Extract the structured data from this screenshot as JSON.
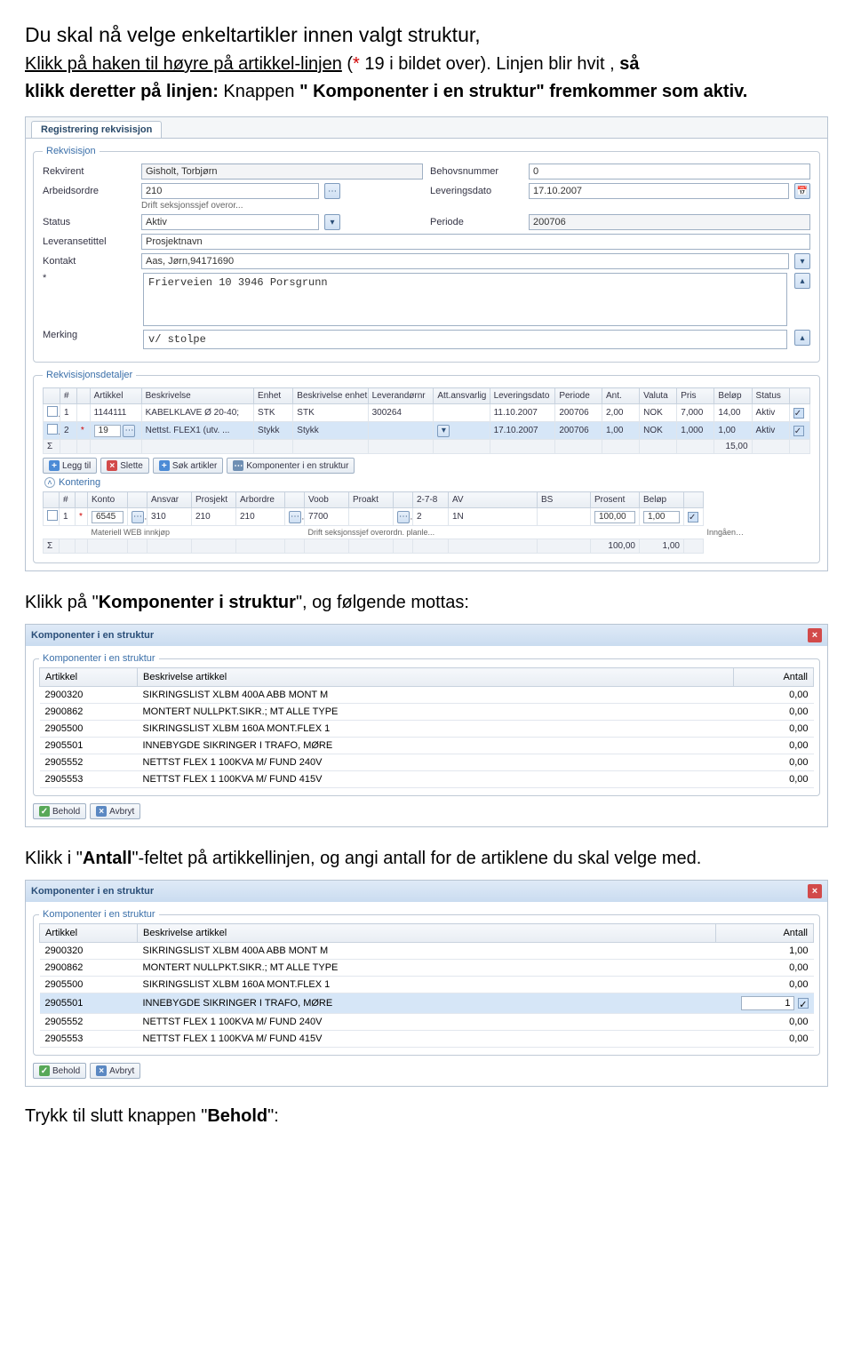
{
  "intro": {
    "line1": "Du skal nå velge enkeltartikler innen valgt struktur,",
    "line2_pre": "Klikk på haken til høyre på artikkel-linjen",
    "line2_paren_open": " (",
    "line2_star": "*",
    "line2_rest": " 19 i bildet over). Linjen blir hvit ,",
    "line2_end_bold": " så",
    "line3_bold1": "klikk deretter på linjen:",
    "line3_plain": "    Knappen ",
    "line3_bold2": "\" Komponenter i en struktur\" fremkommer som aktiv."
  },
  "app": {
    "tab": "Registrering rekvisisjon",
    "rekvisisjon_legend": "Rekvisisjon",
    "labels": {
      "rekvirent": "Rekvirent",
      "arbeidsordre": "Arbeidsordre",
      "status": "Status",
      "leveransetittel": "Leveransetittel",
      "kontakt": "Kontakt",
      "star": "*",
      "merking": "Merking",
      "behovsnummer": "Behovsnummer",
      "leveringsdato": "Leveringsdato",
      "periode": "Periode"
    },
    "values": {
      "rekvirent": "Gisholt, Torbjørn",
      "arbeidsordre": "210",
      "arbeidsordre_sub": "Drift seksjonssjef overor...",
      "status": "Aktiv",
      "leveransetittel": "Prosjektnavn",
      "kontakt": "Aas, Jørn,94171690",
      "adresse": "Frierveien 10 3946 Porsgrunn",
      "merking": "v/ stolpe",
      "behovsnummer": "0",
      "leveringsdato": "17.10.2007",
      "periode": "200706"
    },
    "detaljer_legend": "Rekvisisjonsdetaljer",
    "det_cols": [
      "",
      "#",
      "",
      "Artikkel",
      "Beskrivelse",
      "Enhet",
      "Beskrivelse enhet",
      "Leverandørnr",
      "Att.ansvarlig",
      "Leveringsdato",
      "Periode",
      "Ant.",
      "Valuta",
      "Pris",
      "Beløp",
      "Status",
      ""
    ],
    "det_rows": [
      {
        "n": "1",
        "star": "",
        "art": "1144111",
        "besk": "KABELKLAVE Ø 20-40;",
        "enh": "STK",
        "benh": "STK",
        "lev": "300264",
        "att": "",
        "dato": "11.10.2007",
        "per": "200706",
        "ant": "2,00",
        "val": "NOK",
        "pris": "7,000",
        "bel": "14,00",
        "stat": "Aktiv",
        "sel": false
      },
      {
        "n": "2",
        "star": "*",
        "art": "19",
        "besk": "Nettst. FLEX1 (utv. ...",
        "enh": "Stykk",
        "benh": "Stykk",
        "lev": "",
        "att": "",
        "dato": "17.10.2007",
        "per": "200706",
        "ant": "1,00",
        "val": "NOK",
        "pris": "1,000",
        "bel": "1,00",
        "stat": "Aktiv",
        "sel": true
      }
    ],
    "det_sum_label": "Σ",
    "det_sum": "15,00",
    "det_toolbar": {
      "legg_til": "Legg til",
      "slette": "Slette",
      "sok": "Søk artikler",
      "komp": "Komponenter i en struktur"
    },
    "kont_label": "Kontering",
    "kont_cols": [
      "",
      "#",
      "",
      "Konto",
      "",
      "Ansvar",
      "Prosjekt",
      "Arbordre",
      "",
      "Voob",
      "Proakt",
      "",
      "2-7-8",
      "AV",
      "BS",
      "Prosent",
      "Beløp",
      ""
    ],
    "kont_row": {
      "n": "1",
      "star": "*",
      "konto": "6545",
      "ansvar": "310",
      "prosjekt": "210",
      "arbordre": "210",
      "voob": "7700",
      "proakt": "",
      "t278": "2",
      "av": "1N",
      "bs": "",
      "prosent": "100,00",
      "belop": "1,00",
      "sub_left": "Materiell WEB innkjøp",
      "sub_mid": "Drift seksjonssjef overordn. planle...",
      "sub_right": "Inngående mva std høy sats (netto)"
    },
    "kont_sum_prosent": "100,00",
    "kont_sum_belop": "1,00"
  },
  "mid1_pre": "Klikk på \"",
  "mid1_bold": "Komponenter i struktur",
  "mid1_post": "\", og følgende mottas:",
  "popup": {
    "title": "Komponenter i en struktur",
    "legend": "Komponenter i en struktur",
    "cols": {
      "art": "Artikkel",
      "besk": "Beskrivelse artikkel",
      "ant": "Antall"
    },
    "rows1": [
      {
        "art": "2900320",
        "besk": "SIKRINGSLIST XLBM 400A ABB MONT M",
        "ant": "0,00"
      },
      {
        "art": "2900862",
        "besk": "MONTERT NULLPKT.SIKR.; MT ALLE TYPE",
        "ant": "0,00"
      },
      {
        "art": "2905500",
        "besk": "SIKRINGSLIST XLBM 160A MONT.FLEX 1",
        "ant": "0,00"
      },
      {
        "art": "2905501",
        "besk": "INNEBYGDE SIKRINGER I TRAFO, MØRE",
        "ant": "0,00"
      },
      {
        "art": "2905552",
        "besk": "NETTST FLEX 1 100KVA M/ FUND 240V",
        "ant": "0,00"
      },
      {
        "art": "2905553",
        "besk": "NETTST FLEX 1 100KVA M/ FUND 415V",
        "ant": "0,00"
      }
    ],
    "rows2": [
      {
        "art": "2900320",
        "besk": "SIKRINGSLIST XLBM 400A ABB MONT M",
        "ant": "1,00",
        "sel": false,
        "edit": false
      },
      {
        "art": "2900862",
        "besk": "MONTERT NULLPKT.SIKR.; MT ALLE TYPE",
        "ant": "0,00",
        "sel": false,
        "edit": false
      },
      {
        "art": "2905500",
        "besk": "SIKRINGSLIST XLBM 160A MONT.FLEX 1",
        "ant": "0,00",
        "sel": false,
        "edit": false
      },
      {
        "art": "2905501",
        "besk": "INNEBYGDE SIKRINGER I TRAFO, MØRE",
        "ant": "1",
        "sel": true,
        "edit": true
      },
      {
        "art": "2905552",
        "besk": "NETTST FLEX 1 100KVA M/ FUND 240V",
        "ant": "0,00",
        "sel": false,
        "edit": false
      },
      {
        "art": "2905553",
        "besk": "NETTST FLEX 1 100KVA M/ FUND 415V",
        "ant": "0,00",
        "sel": false,
        "edit": false
      }
    ],
    "behold": "Behold",
    "avbryt": "Avbryt"
  },
  "mid2_pre": "Klikk i \"",
  "mid2_bold": "Antall",
  "mid2_post": "\"-feltet på artikkellinjen, og angi antall for de artiklene du skal velge med.",
  "foot_pre": "Trykk til slutt knappen \"",
  "foot_bold": "Behold",
  "foot_post": "\":"
}
